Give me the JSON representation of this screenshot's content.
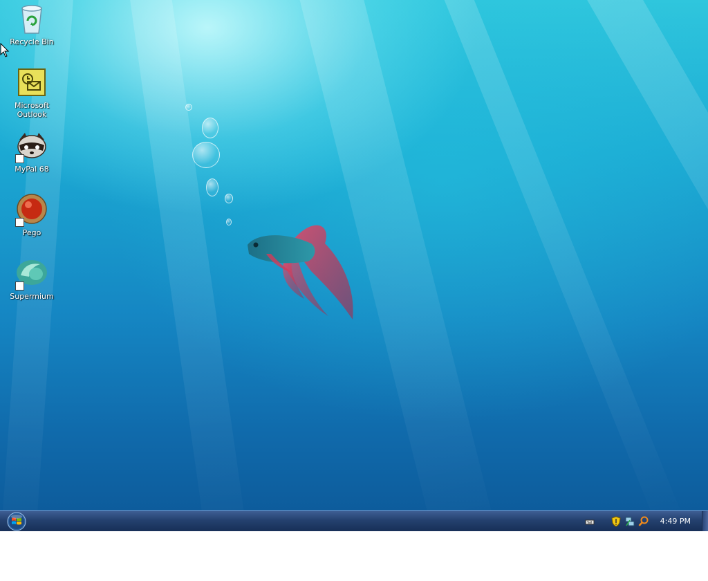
{
  "desktop": {
    "wallpaper": "betta-fish-underwater",
    "icons": [
      {
        "label": "Recycle Bin",
        "icon": "recycle-bin-icon",
        "shortcut": false
      },
      {
        "label": "Microsoft Outlook",
        "icon": "outlook-icon",
        "shortcut": false
      },
      {
        "label": "MyPal 68",
        "icon": "mypal-icon",
        "shortcut": true
      },
      {
        "label": "Pego",
        "icon": "pego-icon",
        "shortcut": true
      },
      {
        "label": "Supermium",
        "icon": "supermium-icon",
        "shortcut": true
      }
    ]
  },
  "taskbar": {
    "start": "start-orb",
    "tray_icons": [
      "keyboard-icon",
      "security-shield-icon",
      "network-icon",
      "search-icon"
    ],
    "clock": "4:49 PM"
  },
  "colors": {
    "desktop_top": "#2fc6dd",
    "desktop_bottom": "#0d5c9c",
    "taskbar": "#24416f"
  }
}
